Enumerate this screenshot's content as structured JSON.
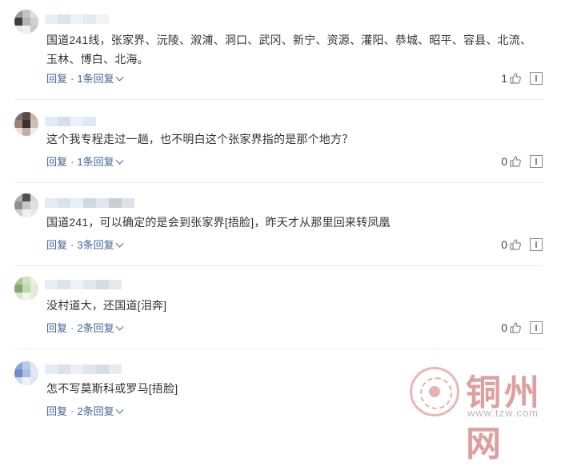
{
  "comments": [
    {
      "text": "国道241线，张家界、沅陵、溆浦、洞口、武冈、新宁、资源、灌阳、恭城、昭平、容县、北流、玉林、博白、北海。",
      "reply_label": "回复",
      "replies_label": "1条回复",
      "likes": "1"
    },
    {
      "text": "这个我专程走过一趟，也不明白这个张家界指的是那个地方？",
      "reply_label": "回复",
      "replies_label": "1条回复",
      "likes": "0"
    },
    {
      "text": "国道241，可以确定的是会到张家界[捂脸]，昨天才从那里回来转凤凰",
      "reply_label": "回复",
      "replies_label": "3条回复",
      "likes": "0"
    },
    {
      "text": "没村道大，还国道[泪奔]",
      "reply_label": "回复",
      "replies_label": "2条回复",
      "likes": "0"
    },
    {
      "text": "怎不写莫斯科或罗马[捂脸]",
      "reply_label": "回复",
      "replies_label": "2条回复",
      "likes": ""
    }
  ],
  "separator": "·",
  "watermark": {
    "title": "铜州网",
    "url": "www.tzw.com"
  },
  "colors": {
    "link": "#406599",
    "watermark": "#d88f8f"
  }
}
